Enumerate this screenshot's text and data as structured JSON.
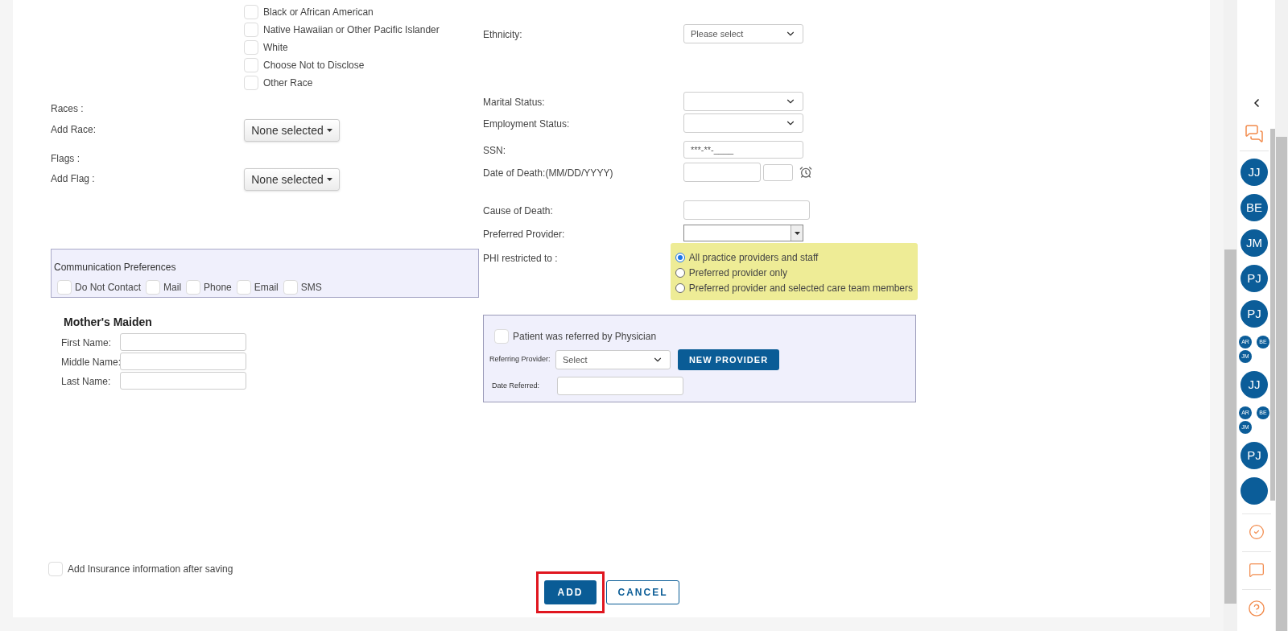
{
  "races": [
    {
      "label": "Black or African American",
      "checked": false
    },
    {
      "label": "Native Hawaiian or Other Pacific Islander",
      "checked": false
    },
    {
      "label": "White",
      "checked": false
    },
    {
      "label": "Choose Not to Disclose",
      "checked": false
    },
    {
      "label": "Other Race",
      "checked": false
    }
  ],
  "races_label": "Races :",
  "add_race": {
    "label": "Add Race:",
    "value": "None selected"
  },
  "flags_label": "Flags :",
  "add_flag": {
    "label": "Add Flag :",
    "value": "None selected"
  },
  "communication": {
    "title": "Communication Preferences",
    "options": [
      {
        "label": "Do Not Contact",
        "checked": false
      },
      {
        "label": "Mail",
        "checked": false
      },
      {
        "label": "Phone",
        "checked": false
      },
      {
        "label": "Email",
        "checked": false
      },
      {
        "label": "SMS",
        "checked": false
      }
    ]
  },
  "mothers_maiden": {
    "title": "Mother's Maiden",
    "fields": [
      {
        "label": "First Name:"
      },
      {
        "label": "Middle Name:"
      },
      {
        "label": "Last Name:"
      }
    ]
  },
  "ethnicity": {
    "label": "Ethnicity:",
    "value": "Please select"
  },
  "marital_status": {
    "label": "Marital Status:"
  },
  "employment_status": {
    "label": "Employment Status:"
  },
  "ssn": {
    "label": "SSN:",
    "value": "***-**-____"
  },
  "date_of_death": {
    "label": "Date of Death:(MM/DD/YYYY)"
  },
  "cause_of_death": {
    "label": "Cause of Death:"
  },
  "preferred_provider": {
    "label": "Preferred Provider:"
  },
  "phi": {
    "label": "PHI restricted to :",
    "options": [
      {
        "label": "All practice providers and staff",
        "selected": true
      },
      {
        "label": "Preferred provider only",
        "selected": false
      },
      {
        "label": "Preferred provider and selected care team members",
        "selected": false
      }
    ]
  },
  "referral": {
    "checkbox": {
      "label": "Patient was referred by Physician",
      "checked": false
    },
    "provider_label": "Referring Provider:",
    "provider_value": "Select",
    "new_provider": "NEW PROVIDER",
    "date_label": "Date Referred:"
  },
  "insurance": {
    "label": "Add Insurance information after saving",
    "checked": false
  },
  "buttons": {
    "add": "ADD",
    "cancel": "CANCEL"
  },
  "sidebar": {
    "avatars": [
      {
        "kind": "single",
        "initials": [
          "JJ"
        ]
      },
      {
        "kind": "single",
        "initials": [
          "BE"
        ]
      },
      {
        "kind": "single",
        "initials": [
          "JM"
        ]
      },
      {
        "kind": "single",
        "initials": [
          "PJ"
        ]
      },
      {
        "kind": "single",
        "initials": [
          "PJ"
        ]
      },
      {
        "kind": "group",
        "initials": [
          "AR",
          "BE",
          "JM"
        ]
      },
      {
        "kind": "single",
        "initials": [
          "JJ"
        ]
      },
      {
        "kind": "group",
        "initials": [
          "AR",
          "BE",
          "JM"
        ]
      },
      {
        "kind": "single",
        "initials": [
          "PJ"
        ]
      },
      {
        "kind": "cut"
      }
    ]
  }
}
